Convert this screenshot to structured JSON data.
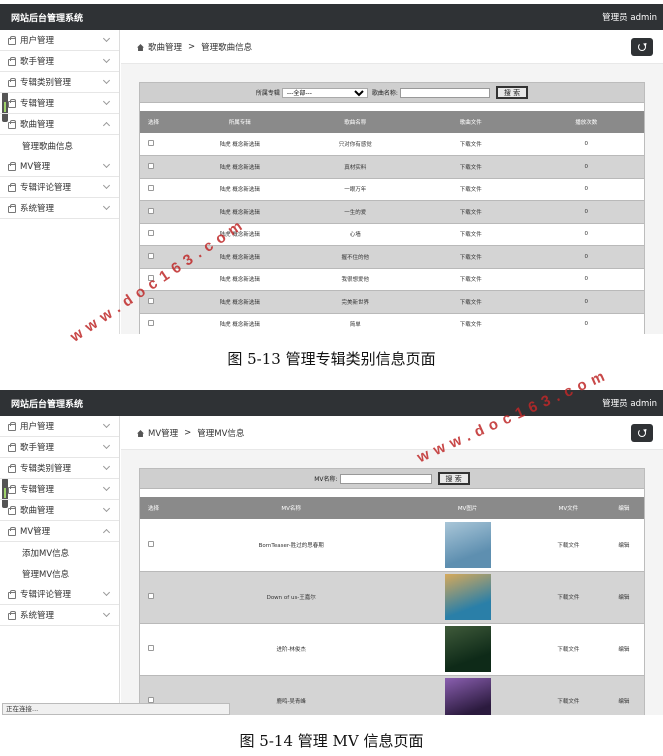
{
  "shots": [
    {
      "app_title": "网站后台管理系统",
      "user_label": "管理员",
      "username": "admin",
      "menu": [
        {
          "label": "用户管理",
          "expanded": false,
          "subitems": []
        },
        {
          "label": "歌手管理",
          "expanded": false,
          "subitems": []
        },
        {
          "label": "专辑类别管理",
          "expanded": false,
          "subitems": []
        },
        {
          "label": "专辑管理",
          "expanded": false,
          "subitems": []
        },
        {
          "label": "歌曲管理",
          "expanded": true,
          "subitems": [
            "管理歌曲信息"
          ]
        },
        {
          "label": "MV管理",
          "expanded": false,
          "subitems": []
        },
        {
          "label": "专辑评论管理",
          "expanded": false,
          "subitems": []
        },
        {
          "label": "系统管理",
          "expanded": false,
          "subitems": []
        }
      ],
      "breadcrumb": {
        "section": "歌曲管理",
        "separator": ">",
        "page": "管理歌曲信息"
      },
      "filters": {
        "album_label": "所属专辑",
        "album_selected": "---全部---",
        "name_label": "歌曲名称:",
        "name_value": "",
        "search_label": "搜 索"
      },
      "table": {
        "headers": [
          "选择",
          "所属专辑",
          "歌曲名称",
          "歌曲文件",
          "播放次数"
        ],
        "rows": [
          [
            "",
            "陆虎 概念新选辑",
            "只对你有感觉",
            "下载文件",
            "0"
          ],
          [
            "",
            "陆虎 概念新选辑",
            "真材实料",
            "下载文件",
            "0"
          ],
          [
            "",
            "陆虎 概念新选辑",
            "一眼万年",
            "下载文件",
            "0"
          ],
          [
            "",
            "陆虎 概念新选辑",
            "一生的爱",
            "下载文件",
            "0"
          ],
          [
            "",
            "陆虎 概念新选辑",
            "心墙",
            "下载文件",
            "0"
          ],
          [
            "",
            "陆虎 概念新选辑",
            "握不住的他",
            "下载文件",
            "0"
          ],
          [
            "",
            "陆虎 概念新选辑",
            "我很想爱他",
            "下载文件",
            "0"
          ],
          [
            "",
            "陆虎 概念新选辑",
            "完美新世界",
            "下载文件",
            "0"
          ],
          [
            "",
            "陆虎 概念新选辑",
            "简单",
            "下载文件",
            "0"
          ]
        ]
      },
      "caption": "图 5-13 管理专辑类别信息页面",
      "watermark": "www.doc163.com"
    },
    {
      "app_title": "网站后台管理系统",
      "user_label": "管理员",
      "username": "admin",
      "menu": [
        {
          "label": "用户管理",
          "expanded": false,
          "subitems": []
        },
        {
          "label": "歌手管理",
          "expanded": false,
          "subitems": []
        },
        {
          "label": "专辑类别管理",
          "expanded": false,
          "subitems": []
        },
        {
          "label": "专辑管理",
          "expanded": false,
          "subitems": []
        },
        {
          "label": "歌曲管理",
          "expanded": false,
          "subitems": []
        },
        {
          "label": "MV管理",
          "expanded": true,
          "subitems": [
            "添加MV信息",
            "管理MV信息"
          ]
        },
        {
          "label": "专辑评论管理",
          "expanded": false,
          "subitems": []
        },
        {
          "label": "系统管理",
          "expanded": false,
          "subitems": []
        }
      ],
      "breadcrumb": {
        "section": "MV管理",
        "separator": ">",
        "page": "管理MV信息"
      },
      "filters": {
        "name_label": "MV名称:",
        "name_value": "",
        "search_label": "搜 索"
      },
      "table": {
        "headers": [
          "选择",
          "MV名称",
          "MV图片",
          "MV文件",
          "编辑"
        ],
        "rows": [
          [
            "",
            "BornTeaser-胜过的思春期",
            "mv-thumb-1",
            "下载文件",
            "编辑"
          ],
          [
            "",
            "Down of us-王嘉尔",
            "mv-thumb-2",
            "下载文件",
            "编辑"
          ],
          [
            "",
            "进阶-林俊杰",
            "mv-thumb-3",
            "下载文件",
            "编辑"
          ],
          [
            "",
            "鹿鸣-吴青峰",
            "mv-thumb-4",
            "下载文件",
            "编辑"
          ]
        ]
      },
      "status_text": "正在连接...",
      "caption": "图 5-14 管理 MV 信息页面",
      "watermark": "www.doc163.com"
    }
  ],
  "colors": {
    "topbar": "#2f3235",
    "table_header": "#8a8a8a",
    "row_alt": "#d4d4d4",
    "watermark": "#be2828"
  },
  "mv_thumbs": {
    "mv-thumb-1": [
      "#5e8fb0",
      "#a9c6d8"
    ],
    "mv-thumb-2": [
      "#2a7fa8",
      "#d6a95a"
    ],
    "mv-thumb-3": [
      "#0e2a18",
      "#3f5a3a"
    ],
    "mv-thumb-4": [
      "#2b1a3e",
      "#8a5fb0"
    ]
  }
}
